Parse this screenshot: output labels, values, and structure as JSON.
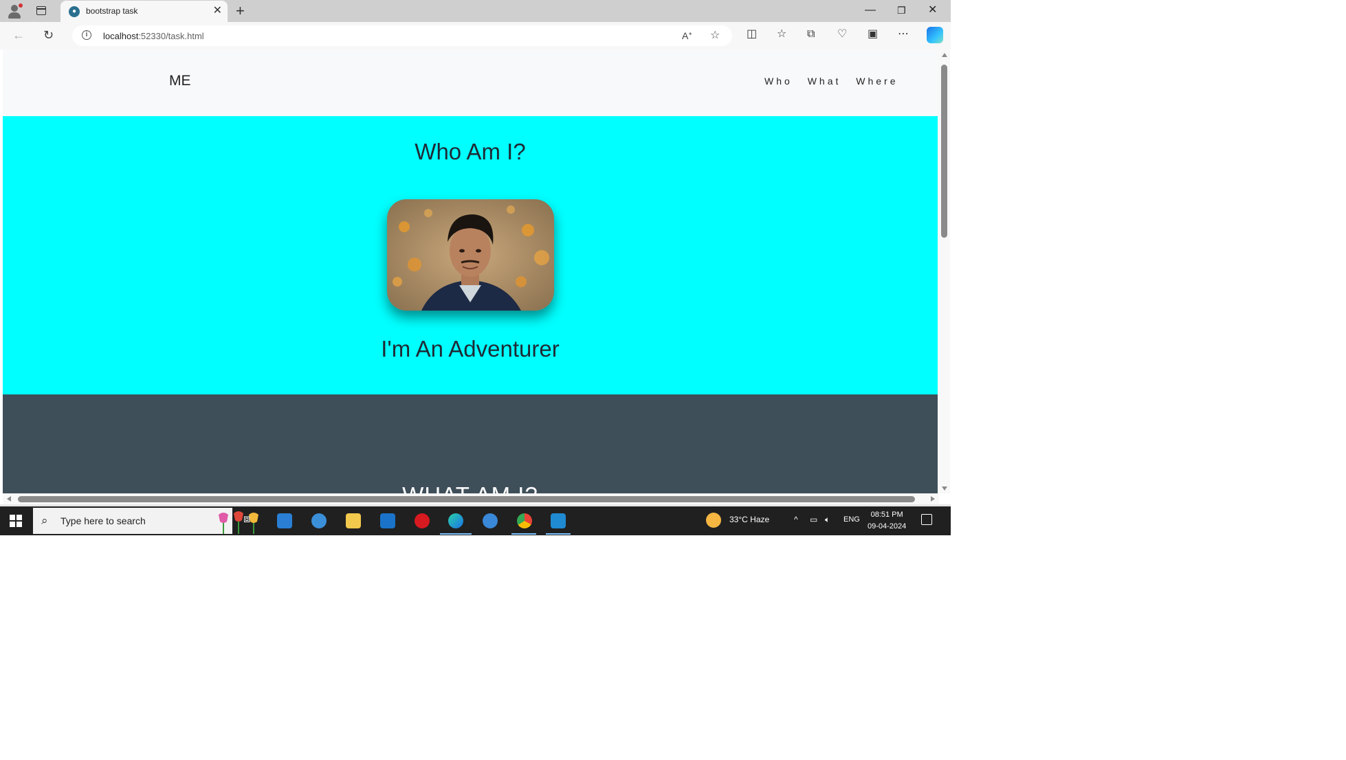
{
  "browser": {
    "tab_title": "bootstrap task",
    "url_host": "localhost",
    "url_rest": ":52330/task.html"
  },
  "page": {
    "brand": "ME",
    "nav_links": [
      "Who",
      "What",
      "Where"
    ],
    "hero_title": "Who Am I?",
    "hero_subtitle": "I'm An Adventurer",
    "section2_title": "WHAT AM I?",
    "colors": {
      "hero_bg": "#00ffff",
      "dark_bg": "#3f4f5a",
      "navbar_bg": "#f8f9fa"
    }
  },
  "taskbar": {
    "search_placeholder": "Type here to search",
    "weather": "33°C  Haze",
    "language": "ENG",
    "time": "08:51 PM",
    "date": "09-04-2024"
  }
}
